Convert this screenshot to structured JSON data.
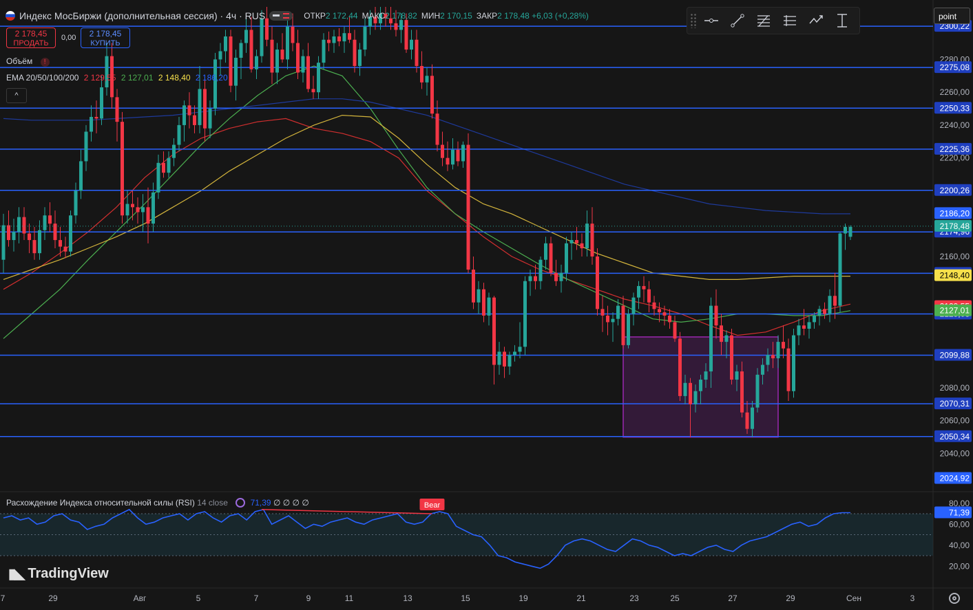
{
  "header": {
    "title": "Индекс МосБиржи (дополнительная сессия) · 4ч · RUS",
    "ohlc": [
      {
        "k": "ОТКР",
        "v": "2 172,44"
      },
      {
        "k": "МАКС",
        "v": "2 178,82"
      },
      {
        "k": "МИН",
        "v": "2 170,15"
      },
      {
        "k": "ЗАКР",
        "v": "2 178,48 +6,03 (+0,28%)"
      }
    ],
    "sell_price": "2 178,45",
    "sell_label": "ПРОДАТЬ",
    "buy_price": "2 178,45",
    "buy_label": "КУПИТЬ",
    "spread": "0,00",
    "volume_label": "Объём",
    "warning_glyph": "!",
    "ema_label": "EMA 20/50/100/200",
    "ema_values": [
      {
        "v": "2 129,55",
        "c": "#f23645"
      },
      {
        "v": "2 127,01",
        "c": "#4caf50"
      },
      {
        "v": "2 148,40",
        "c": "#f6e04b"
      },
      {
        "v": "2 186,20",
        "c": "#2962ff"
      }
    ],
    "collapse_glyph": "^"
  },
  "toolbar": {
    "icons": [
      "horizontal-line-icon",
      "trend-line-icon",
      "fib-retracement-icon",
      "pitchfork-icon",
      "path-icon",
      "price-range-icon"
    ],
    "magnet_label": "point"
  },
  "rsi": {
    "label": "Расхождение Индекса относительной силы (RSI)",
    "params": "14 close",
    "value": "71,39",
    "extras": "∅ ∅ ∅ ∅",
    "bear_label": "Bear",
    "axis": [
      80,
      60,
      40,
      20
    ],
    "axis_labels": [
      "80,00",
      "60,00",
      "40,00",
      "20,00"
    ],
    "current_label": "71,39"
  },
  "brand": "TradingView",
  "colors": {
    "up": "#26a69a",
    "down": "#f23645",
    "levels": "#2962ff",
    "ema20": "#d32f2f",
    "ema50": "#4caf50",
    "ema100": "#d4b53c",
    "ema200": "#1e3a9c",
    "rsi": "#2962ff",
    "zone": "#9c27b0"
  },
  "chart_data": {
    "type": "candlestick",
    "title": "Индекс МосБиржи (дополнительная сессия) · 4ч · RUS",
    "ylim": [
      2018,
      2312
    ],
    "x_ticks": [
      "7",
      "29",
      "Авг",
      "5",
      "7",
      "9",
      "11",
      "13",
      "15",
      "19",
      "21",
      "23",
      "25",
      "27",
      "29",
      "Сен",
      "3"
    ],
    "y_ticks": [
      {
        "v": 2280,
        "label": "2280,00"
      },
      {
        "v": 2260,
        "label": "2260,00"
      },
      {
        "v": 2240,
        "label": "2240,00"
      },
      {
        "v": 2220,
        "label": "2220,00"
      },
      {
        "v": 2160,
        "label": "2160,00"
      },
      {
        "v": 2080,
        "label": "2080,00"
      },
      {
        "v": 2060,
        "label": "2060,00"
      },
      {
        "v": 2040,
        "label": "2040,00"
      }
    ],
    "horizontal_levels": [
      {
        "v": 2300.22,
        "label": "2300,22"
      },
      {
        "v": 2275.08,
        "label": "2275,08"
      },
      {
        "v": 2250.33,
        "label": "2250,33"
      },
      {
        "v": 2225.36,
        "label": "2225,36"
      },
      {
        "v": 2200.26,
        "label": "2200,26"
      },
      {
        "v": 2174.96,
        "label": "2174,96"
      },
      {
        "v": 2149.74,
        "label": "2149,74"
      },
      {
        "v": 2125.03,
        "label": "2125,03"
      },
      {
        "v": 2099.88,
        "label": "2099,88"
      },
      {
        "v": 2070.31,
        "label": "2070,31"
      },
      {
        "v": 2050.34,
        "label": "2050,34"
      }
    ],
    "price_tags": [
      {
        "v": 2186.2,
        "label": "2186,20",
        "bg": "#2962ff",
        "fg": "#ffffff"
      },
      {
        "v": 2178.48,
        "label": "2178,48",
        "bg": "#26a69a",
        "fg": "#ffffff"
      },
      {
        "v": 2148.4,
        "label": "2148,40",
        "bg": "#f6e04b",
        "fg": "#000000"
      },
      {
        "v": 2129.55,
        "label": "2129,55",
        "bg": "#f23645",
        "fg": "#ffffff"
      },
      {
        "v": 2127.01,
        "label": "2127,01",
        "bg": "#4caf50",
        "fg": "#ffffff"
      },
      {
        "v": 2024.92,
        "label": "2024,92",
        "bg": "#2962ff",
        "fg": "#ffffff"
      }
    ],
    "consolidation_box": {
      "from_candle": 120,
      "to_candle": 150,
      "top": 2111,
      "bottom": 2050
    },
    "candles": [
      [
        2158,
        2186,
        2150,
        2179
      ],
      [
        2179,
        2188,
        2166,
        2170
      ],
      [
        2170,
        2183,
        2163,
        2175
      ],
      [
        2175,
        2190,
        2168,
        2184
      ],
      [
        2184,
        2190,
        2170,
        2174
      ],
      [
        2174,
        2180,
        2162,
        2170
      ],
      [
        2170,
        2178,
        2158,
        2162
      ],
      [
        2162,
        2182,
        2158,
        2176
      ],
      [
        2176,
        2190,
        2170,
        2185
      ],
      [
        2185,
        2193,
        2175,
        2180
      ],
      [
        2180,
        2188,
        2165,
        2170
      ],
      [
        2170,
        2178,
        2160,
        2166
      ],
      [
        2166,
        2172,
        2159,
        2163
      ],
      [
        2163,
        2188,
        2160,
        2185
      ],
      [
        2185,
        2205,
        2180,
        2200
      ],
      [
        2200,
        2225,
        2195,
        2218
      ],
      [
        2218,
        2240,
        2212,
        2236
      ],
      [
        2236,
        2252,
        2230,
        2245
      ],
      [
        2245,
        2255,
        2235,
        2244
      ],
      [
        2244,
        2270,
        2240,
        2263
      ],
      [
        2263,
        2290,
        2258,
        2282
      ],
      [
        2282,
        2290,
        2250,
        2257
      ],
      [
        2257,
        2262,
        2230,
        2242
      ],
      [
        2242,
        2248,
        2180,
        2185
      ],
      [
        2185,
        2200,
        2180,
        2192
      ],
      [
        2192,
        2200,
        2182,
        2190
      ],
      [
        2190,
        2196,
        2180,
        2187
      ],
      [
        2187,
        2198,
        2175,
        2190
      ],
      [
        2190,
        2202,
        2168,
        2180
      ],
      [
        2180,
        2205,
        2175,
        2199
      ],
      [
        2199,
        2222,
        2195,
        2217
      ],
      [
        2217,
        2224,
        2208,
        2211
      ],
      [
        2211,
        2224,
        2208,
        2220
      ],
      [
        2220,
        2232,
        2215,
        2228
      ],
      [
        2228,
        2245,
        2224,
        2240
      ],
      [
        2240,
        2255,
        2230,
        2252
      ],
      [
        2252,
        2260,
        2238,
        2246
      ],
      [
        2246,
        2252,
        2235,
        2240
      ],
      [
        2240,
        2276,
        2235,
        2262
      ],
      [
        2262,
        2268,
        2230,
        2238
      ],
      [
        2238,
        2255,
        2232,
        2250
      ],
      [
        2250,
        2284,
        2246,
        2280
      ],
      [
        2280,
        2290,
        2270,
        2285
      ],
      [
        2285,
        2298,
        2278,
        2294
      ],
      [
        2294,
        2298,
        2260,
        2264
      ],
      [
        2264,
        2286,
        2255,
        2281
      ],
      [
        2281,
        2292,
        2268,
        2290
      ],
      [
        2290,
        2305,
        2284,
        2298
      ],
      [
        2298,
        2306,
        2272,
        2274
      ],
      [
        2274,
        2286,
        2268,
        2282
      ],
      [
        2282,
        2310,
        2278,
        2305
      ],
      [
        2305,
        2312,
        2288,
        2292
      ],
      [
        2292,
        2300,
        2265,
        2272
      ],
      [
        2272,
        2290,
        2265,
        2286
      ],
      [
        2286,
        2296,
        2278,
        2280
      ],
      [
        2280,
        2305,
        2274,
        2300
      ],
      [
        2300,
        2308,
        2285,
        2290
      ],
      [
        2290,
        2298,
        2268,
        2272
      ],
      [
        2272,
        2286,
        2266,
        2282
      ],
      [
        2282,
        2290,
        2260,
        2262
      ],
      [
        2262,
        2270,
        2256,
        2260
      ],
      [
        2260,
        2282,
        2256,
        2278
      ],
      [
        2278,
        2296,
        2274,
        2292
      ],
      [
        2292,
        2297,
        2285,
        2290
      ],
      [
        2290,
        2298,
        2284,
        2294
      ],
      [
        2294,
        2299,
        2288,
        2291
      ],
      [
        2291,
        2300,
        2284,
        2296
      ],
      [
        2296,
        2306,
        2290,
        2292
      ],
      [
        2292,
        2298,
        2272,
        2276
      ],
      [
        2276,
        2290,
        2270,
        2286
      ],
      [
        2286,
        2305,
        2282,
        2300
      ],
      [
        2300,
        2310,
        2295,
        2306
      ],
      [
        2306,
        2312,
        2298,
        2302
      ],
      [
        2302,
        2312,
        2298,
        2308
      ],
      [
        2308,
        2312,
        2300,
        2305
      ],
      [
        2305,
        2312,
        2298,
        2302
      ],
      [
        2302,
        2310,
        2294,
        2298
      ],
      [
        2298,
        2308,
        2290,
        2304
      ],
      [
        2304,
        2308,
        2284,
        2286
      ],
      [
        2286,
        2298,
        2280,
        2292
      ],
      [
        2292,
        2298,
        2272,
        2276
      ],
      [
        2276,
        2285,
        2262,
        2266
      ],
      [
        2266,
        2275,
        2258,
        2270
      ],
      [
        2270,
        2277,
        2244,
        2247
      ],
      [
        2247,
        2255,
        2224,
        2228
      ],
      [
        2228,
        2236,
        2215,
        2220
      ],
      [
        2220,
        2230,
        2212,
        2216
      ],
      [
        2216,
        2232,
        2213,
        2225
      ],
      [
        2225,
        2230,
        2215,
        2218
      ],
      [
        2218,
        2230,
        2214,
        2228
      ],
      [
        2228,
        2235,
        2150,
        2152
      ],
      [
        2152,
        2160,
        2128,
        2132
      ],
      [
        2132,
        2145,
        2125,
        2140
      ],
      [
        2140,
        2144,
        2120,
        2124
      ],
      [
        2124,
        2138,
        2118,
        2135
      ],
      [
        2135,
        2136,
        2082,
        2094
      ],
      [
        2094,
        2108,
        2088,
        2102
      ],
      [
        2102,
        2105,
        2086,
        2093
      ],
      [
        2093,
        2102,
        2088,
        2100
      ],
      [
        2100,
        2106,
        2096,
        2102
      ],
      [
        2102,
        2120,
        2098,
        2105
      ],
      [
        2105,
        2148,
        2100,
        2145
      ],
      [
        2145,
        2152,
        2136,
        2148
      ],
      [
        2148,
        2155,
        2140,
        2145
      ],
      [
        2145,
        2160,
        2140,
        2158
      ],
      [
        2158,
        2172,
        2152,
        2168
      ],
      [
        2168,
        2172,
        2148,
        2150
      ],
      [
        2150,
        2158,
        2142,
        2145
      ],
      [
        2145,
        2155,
        2138,
        2150
      ],
      [
        2150,
        2172,
        2145,
        2168
      ],
      [
        2168,
        2175,
        2158,
        2170
      ],
      [
        2170,
        2178,
        2164,
        2168
      ],
      [
        2168,
        2174,
        2160,
        2165
      ],
      [
        2165,
        2188,
        2160,
        2180
      ],
      [
        2180,
        2190,
        2155,
        2160
      ],
      [
        2160,
        2165,
        2124,
        2128
      ],
      [
        2128,
        2136,
        2114,
        2124
      ],
      [
        2124,
        2130,
        2112,
        2120
      ],
      [
        2120,
        2126,
        2108,
        2122
      ],
      [
        2122,
        2134,
        2118,
        2130
      ],
      [
        2130,
        2136,
        2104,
        2106
      ],
      [
        2106,
        2128,
        2104,
        2125
      ],
      [
        2125,
        2138,
        2118,
        2135
      ],
      [
        2135,
        2145,
        2128,
        2142
      ],
      [
        2142,
        2148,
        2132,
        2140
      ],
      [
        2140,
        2145,
        2126,
        2132
      ],
      [
        2132,
        2136,
        2124,
        2128
      ],
      [
        2128,
        2132,
        2120,
        2126
      ],
      [
        2126,
        2130,
        2118,
        2124
      ],
      [
        2124,
        2128,
        2116,
        2120
      ],
      [
        2120,
        2124,
        2108,
        2110
      ],
      [
        2110,
        2114,
        2072,
        2075
      ],
      [
        2075,
        2088,
        2070,
        2083
      ],
      [
        2083,
        2086,
        2050,
        2070
      ],
      [
        2070,
        2082,
        2065,
        2078
      ],
      [
        2078,
        2088,
        2070,
        2085
      ],
      [
        2085,
        2095,
        2080,
        2090
      ],
      [
        2090,
        2135,
        2080,
        2130
      ],
      [
        2130,
        2140,
        2110,
        2118
      ],
      [
        2118,
        2125,
        2100,
        2108
      ],
      [
        2108,
        2115,
        2098,
        2112
      ],
      [
        2112,
        2116,
        2082,
        2085
      ],
      [
        2085,
        2094,
        2078,
        2090
      ],
      [
        2090,
        2096,
        2062,
        2065
      ],
      [
        2065,
        2072,
        2052,
        2055
      ],
      [
        2055,
        2072,
        2050,
        2068
      ],
      [
        2068,
        2092,
        2065,
        2088
      ],
      [
        2088,
        2098,
        2082,
        2094
      ],
      [
        2094,
        2104,
        2090,
        2100
      ],
      [
        2100,
        2108,
        2092,
        2098
      ],
      [
        2098,
        2112,
        2092,
        2108
      ],
      [
        2108,
        2118,
        2098,
        2104
      ],
      [
        2104,
        2110,
        2072,
        2078
      ],
      [
        2078,
        2116,
        2074,
        2112
      ],
      [
        2112,
        2122,
        2106,
        2118
      ],
      [
        2118,
        2128,
        2112,
        2116
      ],
      [
        2116,
        2124,
        2110,
        2120
      ],
      [
        2120,
        2126,
        2116,
        2124
      ],
      [
        2124,
        2130,
        2118,
        2128
      ],
      [
        2128,
        2132,
        2122,
        2125
      ],
      [
        2125,
        2140,
        2120,
        2136
      ],
      [
        2136,
        2150,
        2122,
        2130
      ],
      [
        2130,
        2175,
        2126,
        2174
      ],
      [
        2174,
        2180,
        2164,
        2178
      ],
      [
        2172,
        2179,
        2170,
        2178
      ]
    ],
    "ema_series": [
      {
        "name": "EMA 20",
        "values": [
          2140,
          2150,
          2162,
          2175,
          2190,
          2208,
          2222,
          2232,
          2238,
          2242,
          2244,
          2238,
          2235,
          2230,
          2220,
          2200,
          2186,
          2172,
          2160,
          2152,
          2146,
          2140,
          2134,
          2130,
          2125,
          2118,
          2112,
          2114,
          2120,
          2127,
          2131
        ]
      },
      {
        "name": "EMA 50",
        "values": [
          2110,
          2125,
          2140,
          2158,
          2175,
          2192,
          2210,
          2228,
          2244,
          2258,
          2270,
          2276,
          2270,
          2250,
          2225,
          2202,
          2186,
          2175,
          2165,
          2155,
          2146,
          2138,
          2130,
          2122,
          2120,
          2122,
          2125,
          2125,
          2124,
          2124,
          2127
        ]
      },
      {
        "name": "EMA 100",
        "values": [
          2146,
          2152,
          2158,
          2165,
          2172,
          2180,
          2190,
          2200,
          2212,
          2222,
          2232,
          2240,
          2246,
          2245,
          2232,
          2216,
          2202,
          2192,
          2186,
          2178,
          2170,
          2162,
          2156,
          2150,
          2148,
          2146,
          2146,
          2147,
          2148,
          2148,
          2148
        ]
      },
      {
        "name": "EMA 200",
        "values": [
          2244,
          2243,
          2243,
          2243,
          2244,
          2245,
          2246,
          2248,
          2250,
          2252,
          2254,
          2256,
          2256,
          2254,
          2250,
          2246,
          2240,
          2234,
          2228,
          2222,
          2216,
          2210,
          2204,
          2200,
          2196,
          2192,
          2190,
          2188,
          2187,
          2186,
          2186
        ]
      }
    ],
    "rsi_series": [
      66,
      68,
      64,
      66,
      60,
      62,
      68,
      70,
      64,
      62,
      55,
      58,
      60,
      66,
      70,
      74,
      66,
      60,
      62,
      66,
      68,
      70,
      64,
      70,
      72,
      66,
      62,
      68,
      70,
      64,
      72,
      74,
      60,
      64,
      68,
      62,
      56,
      60,
      58,
      62,
      64,
      66,
      62,
      60,
      64,
      66,
      68,
      70,
      62,
      60,
      62,
      70,
      72,
      70,
      58,
      54,
      50,
      48,
      40,
      30,
      28,
      24,
      22,
      20,
      18,
      22,
      30,
      40,
      44,
      46,
      44,
      40,
      36,
      34,
      40,
      46,
      44,
      40,
      38,
      34,
      30,
      32,
      30,
      34,
      38,
      40,
      36,
      34,
      40,
      44,
      46,
      48,
      52,
      56,
      60,
      62,
      58,
      60,
      66,
      70,
      71,
      71
    ]
  }
}
